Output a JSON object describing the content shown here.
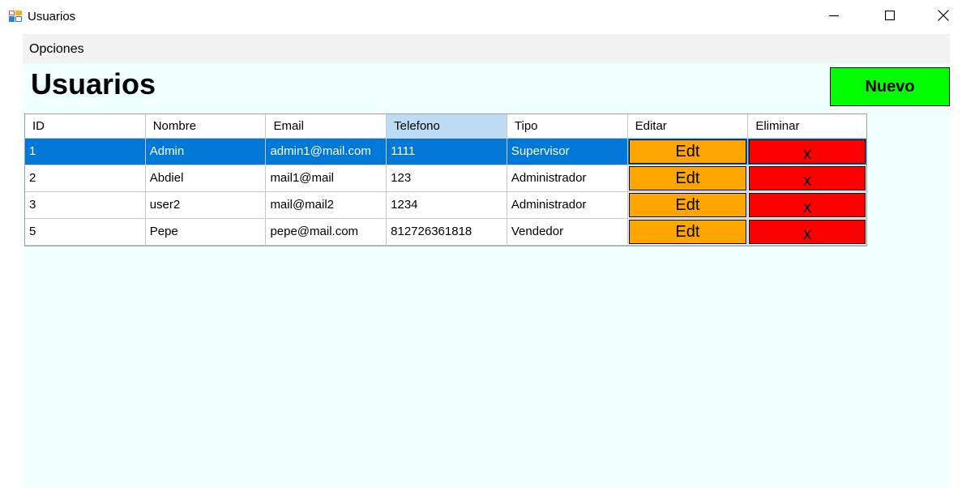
{
  "window": {
    "title": "Usuarios",
    "icon": "windows-form-icon"
  },
  "menu": {
    "items": [
      {
        "label": "Opciones"
      }
    ]
  },
  "page": {
    "title": "Usuarios",
    "new_button_label": "Nuevo"
  },
  "table": {
    "columns": [
      "ID",
      "Nombre",
      "Email",
      "Telefono",
      "Tipo",
      "Editar",
      "Eliminar"
    ],
    "sorted_column": "Telefono",
    "rows": [
      {
        "id": "1",
        "nombre": "Admin",
        "email": "admin1@mail.com",
        "telefono": "1111",
        "tipo": "Supervisor",
        "editar": "Edt",
        "eliminar": "x",
        "selected": true
      },
      {
        "id": "2",
        "nombre": "Abdiel",
        "email": "mail1@mail",
        "telefono": "123",
        "tipo": "Administrador",
        "editar": "Edt",
        "eliminar": "x",
        "selected": false
      },
      {
        "id": "3",
        "nombre": "user2",
        "email": "mail@mail2",
        "telefono": "1234",
        "tipo": "Administrador",
        "editar": "Edt",
        "eliminar": "x",
        "selected": false
      },
      {
        "id": "5",
        "nombre": "Pepe",
        "email": "pepe@mail.com",
        "telefono": "812726361818",
        "tipo": "Vendedor",
        "editar": "Edt",
        "eliminar": "x",
        "selected": false
      }
    ]
  },
  "colors": {
    "new_button": "#00ff00",
    "edit_button": "#ffa500",
    "delete_button": "#ff0000",
    "selection": "#0078d7",
    "client_background": "#f0ffff"
  }
}
